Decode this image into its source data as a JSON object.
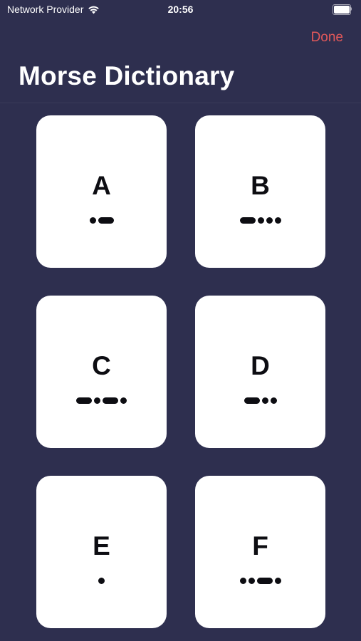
{
  "status_bar": {
    "carrier": "Network Provider",
    "time": "20:56",
    "wifi_icon": "wifi-icon",
    "battery_icon": "battery-icon"
  },
  "nav": {
    "done_label": "Done",
    "title": "Morse Dictionary"
  },
  "colors": {
    "background": "#2e2f4f",
    "accent": "#e2585a",
    "card": "#ffffff",
    "glyph": "#0d0d12"
  },
  "cards": [
    {
      "letter": "A",
      "code": ".-"
    },
    {
      "letter": "B",
      "code": "-..."
    },
    {
      "letter": "C",
      "code": "-.-."
    },
    {
      "letter": "D",
      "code": "-.."
    },
    {
      "letter": "E",
      "code": "."
    },
    {
      "letter": "F",
      "code": "..-."
    }
  ]
}
